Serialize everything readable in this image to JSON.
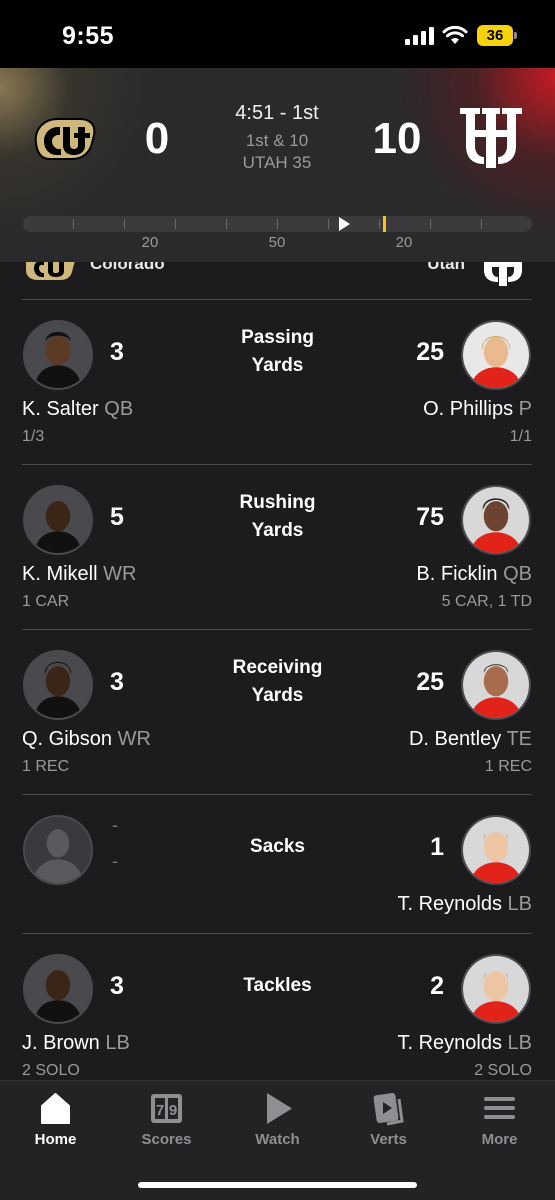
{
  "status_bar": {
    "time": "9:55",
    "battery": "36"
  },
  "game": {
    "home_team": "Colorado",
    "away_team": "Utah",
    "home_score": "0",
    "away_score": "10",
    "clock": "4:51 - 1st",
    "down_distance": "1st & 10",
    "ball_on": "UTAH 35",
    "yard_labels": [
      "20",
      "50",
      "20"
    ],
    "ball_position_fraction": 0.62,
    "first_down_fraction": 0.708
  },
  "leaders": [
    {
      "category_line1": "Passing",
      "category_line2": "Yards",
      "left": {
        "value": "3",
        "name": "K. Salter",
        "pos": "QB",
        "detail": "1/3"
      },
      "right": {
        "value": "25",
        "name": "O. Phillips",
        "pos": "P",
        "detail": "1/1"
      }
    },
    {
      "category_line1": "Rushing",
      "category_line2": "Yards",
      "left": {
        "value": "5",
        "name": "K. Mikell",
        "pos": "WR",
        "detail": "1 CAR"
      },
      "right": {
        "value": "75",
        "name": "B. Ficklin",
        "pos": "QB",
        "detail": "5 CAR, 1 TD"
      }
    },
    {
      "category_line1": "Receiving",
      "category_line2": "Yards",
      "left": {
        "value": "3",
        "name": "Q. Gibson",
        "pos": "WR",
        "detail": "1 REC"
      },
      "right": {
        "value": "25",
        "name": "D. Bentley",
        "pos": "TE",
        "detail": "1 REC"
      }
    },
    {
      "category_line1": "Sacks",
      "category_line2": "",
      "left": {
        "value1": "-",
        "value2": "-"
      },
      "right": {
        "value": "1",
        "name": "T. Reynolds",
        "pos": "LB",
        "detail": ""
      }
    },
    {
      "category_line1": "Tackles",
      "category_line2": "",
      "left": {
        "value": "3",
        "name": "J. Brown",
        "pos": "LB",
        "detail": "2 SOLO"
      },
      "right": {
        "value": "2",
        "name": "T. Reynolds",
        "pos": "LB",
        "detail": "2 SOLO"
      }
    }
  ],
  "tabs": [
    {
      "label": "Home",
      "icon": "home-icon",
      "active": true
    },
    {
      "label": "Scores",
      "icon": "scores-icon",
      "active": false
    },
    {
      "label": "Watch",
      "icon": "watch-icon",
      "active": false
    },
    {
      "label": "Verts",
      "icon": "verts-icon",
      "active": false
    },
    {
      "label": "More",
      "icon": "more-icon",
      "active": false
    }
  ],
  "colors": {
    "colorado_gold": "#cfb87c",
    "utah_red": "#e2231a",
    "first_down": "#f5c518"
  }
}
